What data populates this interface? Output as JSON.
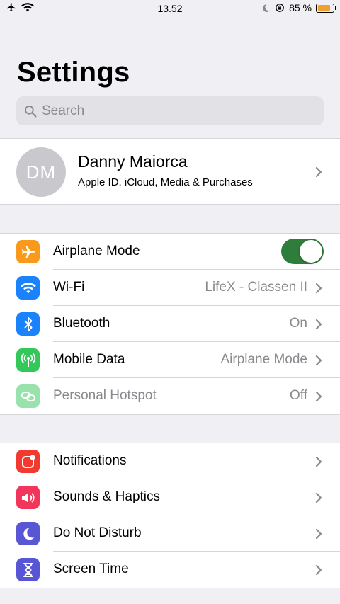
{
  "status_bar": {
    "time": "13.52",
    "battery": "85 %",
    "battery_level": 0.85,
    "icons": [
      "airplane-icon",
      "wifi-icon",
      "moon-icon",
      "orientation-lock-icon",
      "battery-icon"
    ]
  },
  "header": {
    "title": "Settings"
  },
  "search": {
    "placeholder": "Search"
  },
  "profile": {
    "initials": "DM",
    "name": "Danny Maiorca",
    "subtitle": "Apple ID, iCloud, Media & Purchases"
  },
  "connectivity": [
    {
      "label": "Airplane Mode",
      "icon": "airplane-icon",
      "color": "#f99a1c",
      "toggle_on": true
    },
    {
      "label": "Wi-Fi",
      "icon": "wifi-icon",
      "color": "#1a82fb",
      "value": "LifeX - Classen II"
    },
    {
      "label": "Bluetooth",
      "icon": "bluetooth-icon",
      "color": "#1a82fb",
      "value": "On"
    },
    {
      "label": "Mobile Data",
      "icon": "antenna-icon",
      "color": "#34c759",
      "value": "Airplane Mode"
    },
    {
      "label": "Personal Hotspot",
      "icon": "hotspot-icon",
      "color": "#34c759",
      "value": "Off",
      "disabled": true
    }
  ],
  "general": [
    {
      "label": "Notifications",
      "icon": "notifications-icon",
      "color": "#f23a30"
    },
    {
      "label": "Sounds & Haptics",
      "icon": "speaker-icon",
      "color": "#f2355a"
    },
    {
      "label": "Do Not Disturb",
      "icon": "moon-icon",
      "color": "#5956d6"
    },
    {
      "label": "Screen Time",
      "icon": "hourglass-icon",
      "color": "#5956d6"
    }
  ],
  "colors": {
    "background": "#efeff4",
    "toggle_on": "#2e7d3a",
    "secondary_text": "#8a8a8e"
  }
}
